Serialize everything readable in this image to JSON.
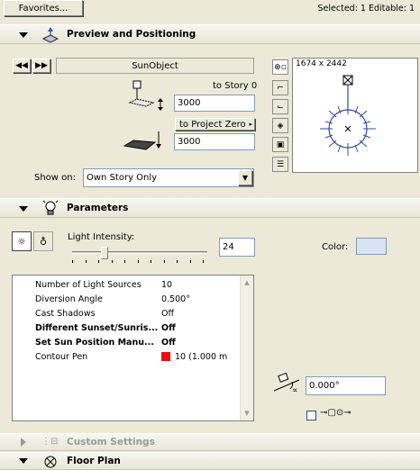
{
  "toolbar": {
    "favorites_label": "Favorites...",
    "status_text": "Selected: 1 Editable: 1"
  },
  "preview": {
    "title": "Preview and Positioning",
    "object_name": "SunObject",
    "to_story_label": "to Story 0",
    "story_elevation": "3000",
    "to_project_zero_label": "to Project Zero",
    "project_zero_elevation": "3000",
    "show_on_label": "Show on:",
    "show_on_value": "Own Story Only",
    "canvas_size": "1674 x 2442"
  },
  "parameters": {
    "title": "Parameters",
    "light_intensity_label": "Light Intensity:",
    "light_intensity_value": "24",
    "light_intensity_fraction": 0.24,
    "color_label": "Color:",
    "color_swatch": "#D8E4F4",
    "rows": [
      {
        "name": "Number of Light Sources",
        "value": "10",
        "bold": false
      },
      {
        "name": "Diversion Angle",
        "value": "0.500°",
        "bold": false
      },
      {
        "name": "Cast Shadows",
        "value": "Off",
        "bold": false
      },
      {
        "name": "Different Sunset/Sunris...",
        "value": "Off",
        "bold": true
      },
      {
        "name": "Set Sun Position Manu...",
        "value": "Off",
        "bold": true
      },
      {
        "name": "Contour Pen",
        "value": "10 (1.000 m",
        "bold": false,
        "swatch": "#E81010"
      }
    ],
    "angle_value": "0.000°"
  },
  "custom_settings": {
    "title": "Custom Settings"
  },
  "floor_plan": {
    "title": "Floor Plan"
  }
}
